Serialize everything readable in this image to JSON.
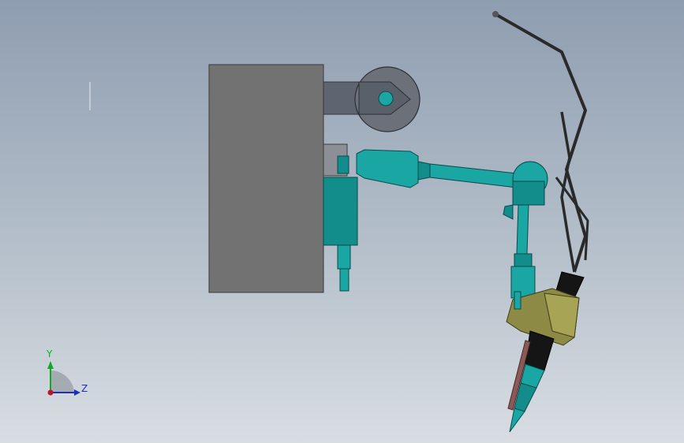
{
  "axes": {
    "y_label": "Y",
    "z_label": "Z"
  },
  "colors": {
    "background_top": "#8e9db0",
    "background_bottom": "#d8dde2",
    "body_gray": "#727272",
    "bracket_slate": "#5f6570",
    "teal": "#138c8c",
    "teal_light": "#1aa7a4",
    "olive": "#8c8a45",
    "torch_red": "#8b5a56",
    "cable": "#2a2a2a",
    "axis_y": "#11a82c",
    "axis_z": "#1b2fb8",
    "axis_origin": "#c0142a"
  },
  "icons": {
    "triad": "coordinate-triad-icon"
  }
}
